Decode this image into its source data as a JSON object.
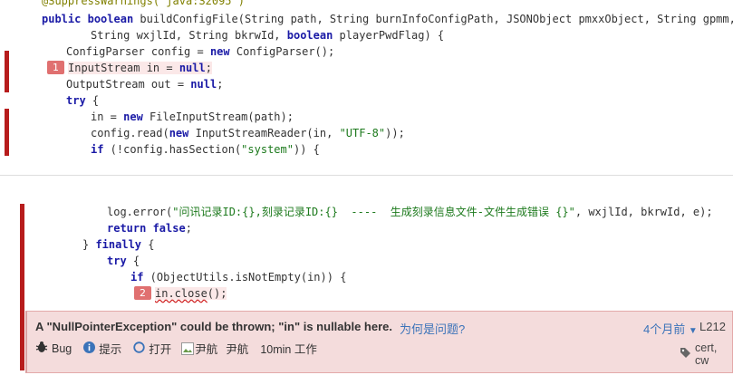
{
  "top_code": {
    "l1": "@SuppressWarnings(\"java:S2095\")",
    "l2a": "public",
    "l2b": "boolean",
    "l2c": " buildConfigFile(String path, String burnInfoConfigPath, JSONObject pmxxObject, String gpmm,",
    "l3a": "String wxjlId, String bkrwId, ",
    "l3b": "boolean",
    "l3c": " playerPwdFlag) {",
    "l4a": "ConfigParser config = ",
    "l4b": "new",
    "l4c": " ConfigParser();",
    "l5_badge": "1",
    "l5a": "InputStream in = ",
    "l5b": "null",
    "l5c": ";",
    "l6a": "OutputStream out = ",
    "l6b": "null",
    "l6c": ";",
    "l7": "try",
    "l7b": " {",
    "l8a": "in = ",
    "l8b": "new",
    "l8c": " FileInputStream(path);",
    "l9a": "config.read(",
    "l9b": "new",
    "l9c": " InputStreamReader(in, ",
    "l9d": "\"UTF-8\"",
    "l9e": "));",
    "l10a": "if",
    "l10b": " (!config.hasSection(",
    "l10c": "\"system\"",
    "l10d": ")) {"
  },
  "bottom_code": {
    "b1a": "log.error(",
    "b1b": "\"问讯记录ID:{},刻录记录ID:{}  ----  生成刻录信息文件-文件生成错误 {}\"",
    "b1c": ", wxjlId, bkrwId, e);",
    "b2a": "return",
    "b2b": " false",
    "b2c": ";",
    "b3a": "} ",
    "b3b": "finally",
    "b3c": " {",
    "b4a": "try",
    "b4b": " {",
    "b5a": "if",
    "b5b": " (ObjectUtils.isNotEmpty(in)) {",
    "b6_badge": "2",
    "b6a": "in.close",
    "b6b": "();"
  },
  "issue": {
    "title": "A \"NullPointerException\" could be thrown; \"in\" is nullable here.",
    "why_link": "为何是问题?",
    "age": "4个月前",
    "line": "L212",
    "type": "Bug",
    "severity": "提示",
    "status": "打开",
    "assignee_alt": "尹航",
    "assignee": "尹航",
    "effort": "10min 工作",
    "tags": "cert, cw"
  },
  "colors": {
    "accent_red": "#b71c1c",
    "issue_bg": "#f4dcdc",
    "link_blue": "#3b73b9"
  }
}
